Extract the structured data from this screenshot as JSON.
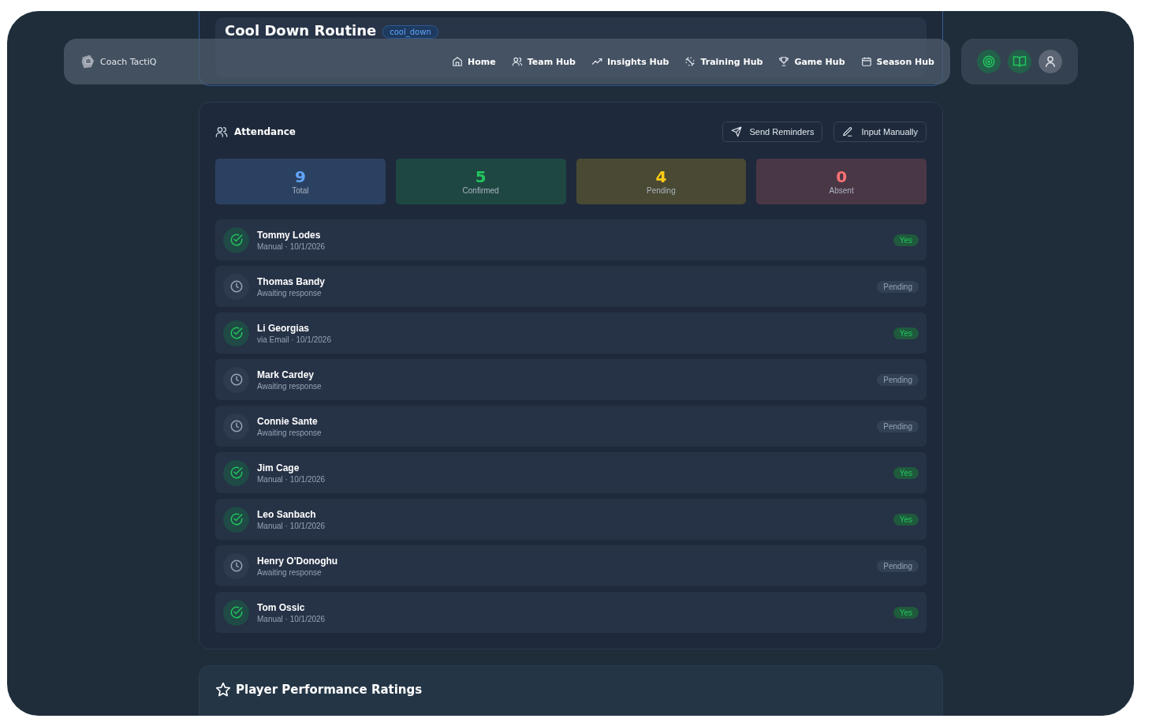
{
  "session": {
    "title": "Cool Down Routine",
    "tag": "cool_down"
  },
  "nav": {
    "brand": "Coach TactiQ",
    "items": [
      {
        "label": "Home"
      },
      {
        "label": "Team Hub"
      },
      {
        "label": "Insights Hub"
      },
      {
        "label": "Training Hub"
      },
      {
        "label": "Game Hub"
      },
      {
        "label": "Season Hub"
      }
    ]
  },
  "attendance": {
    "title": "Attendance",
    "buttons": [
      {
        "label": "Send Reminders"
      },
      {
        "label": "Input Manually"
      }
    ],
    "stats": [
      {
        "value": "9",
        "label": "Total",
        "color": "#60a5fa"
      },
      {
        "value": "5",
        "label": "Confirmed",
        "color": "#22c55e"
      },
      {
        "value": "4",
        "label": "Pending",
        "color": "#facc15"
      },
      {
        "value": "0",
        "label": "Absent",
        "color": "#f87171"
      }
    ],
    "players": [
      {
        "name": "Tommy Lodes",
        "detail": "Manual · 10/1/2026",
        "kind": "yes",
        "status": "Yes"
      },
      {
        "name": "Thomas Bandy",
        "detail": "Awaiting response",
        "kind": "pending",
        "status": "Pending"
      },
      {
        "name": "Li Georgias",
        "detail": "via Email · 10/1/2026",
        "kind": "yes",
        "status": "Yes"
      },
      {
        "name": "Mark Cardey",
        "detail": "Awaiting response",
        "kind": "pending",
        "status": "Pending"
      },
      {
        "name": "Connie Sante",
        "detail": "Awaiting response",
        "kind": "pending",
        "status": "Pending"
      },
      {
        "name": "Jim Cage",
        "detail": "Manual · 10/1/2026",
        "kind": "yes",
        "status": "Yes"
      },
      {
        "name": "Leo Sanbach",
        "detail": "Manual · 10/1/2026",
        "kind": "yes",
        "status": "Yes"
      },
      {
        "name": "Henry O'Donoghu",
        "detail": "Awaiting response",
        "kind": "pending",
        "status": "Pending"
      },
      {
        "name": "Tom Ossic",
        "detail": "Manual · 10/1/2026",
        "kind": "yes",
        "status": "Yes"
      }
    ]
  },
  "ratings": {
    "title": "Player Performance Ratings"
  }
}
